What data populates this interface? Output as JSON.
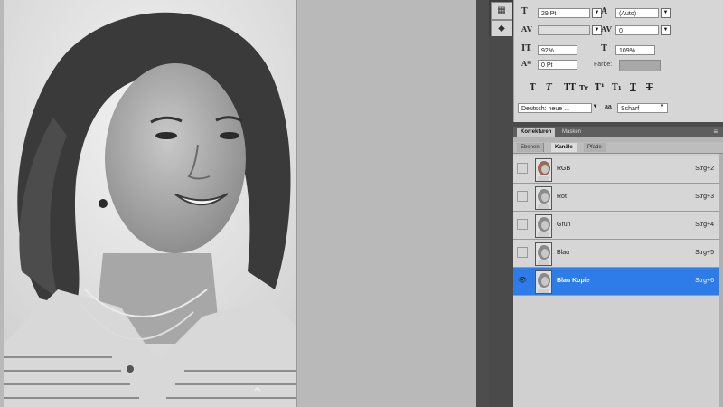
{
  "character": {
    "font_size": "29 Pt",
    "leading": "(Auto)",
    "kerning": "",
    "tracking": "0",
    "vertical_scale": "92%",
    "horizontal_scale": "109%",
    "baseline_shift": "0 Pt",
    "color_label": "Farbe:",
    "color_value": "#a8a8a8",
    "language": "Deutsch: neue ...",
    "antialias_prefix": "aa",
    "antialias": "Scharf",
    "style_buttons": [
      "T",
      "T",
      "TT",
      "Tr",
      "T¹",
      "T₁",
      "T",
      "T"
    ]
  },
  "panel": {
    "tabs_top": [
      "Korrekturen",
      "Masken"
    ],
    "tabs": [
      "Ebenen",
      "Kanäle",
      "Pfade"
    ]
  },
  "channels": [
    {
      "name": "RGB",
      "shortcut": "Strg+2",
      "visible": false,
      "selected": false
    },
    {
      "name": "Rot",
      "shortcut": "Strg+3",
      "visible": false,
      "selected": false
    },
    {
      "name": "Grün",
      "shortcut": "Strg+4",
      "visible": false,
      "selected": false
    },
    {
      "name": "Blau",
      "shortcut": "Strg+5",
      "visible": false,
      "selected": false
    },
    {
      "name": "Blau Kopie",
      "shortcut": "Strg+6",
      "visible": true,
      "selected": true
    }
  ],
  "icons": {
    "eye": "👁",
    "scroll_up": "⌃"
  }
}
